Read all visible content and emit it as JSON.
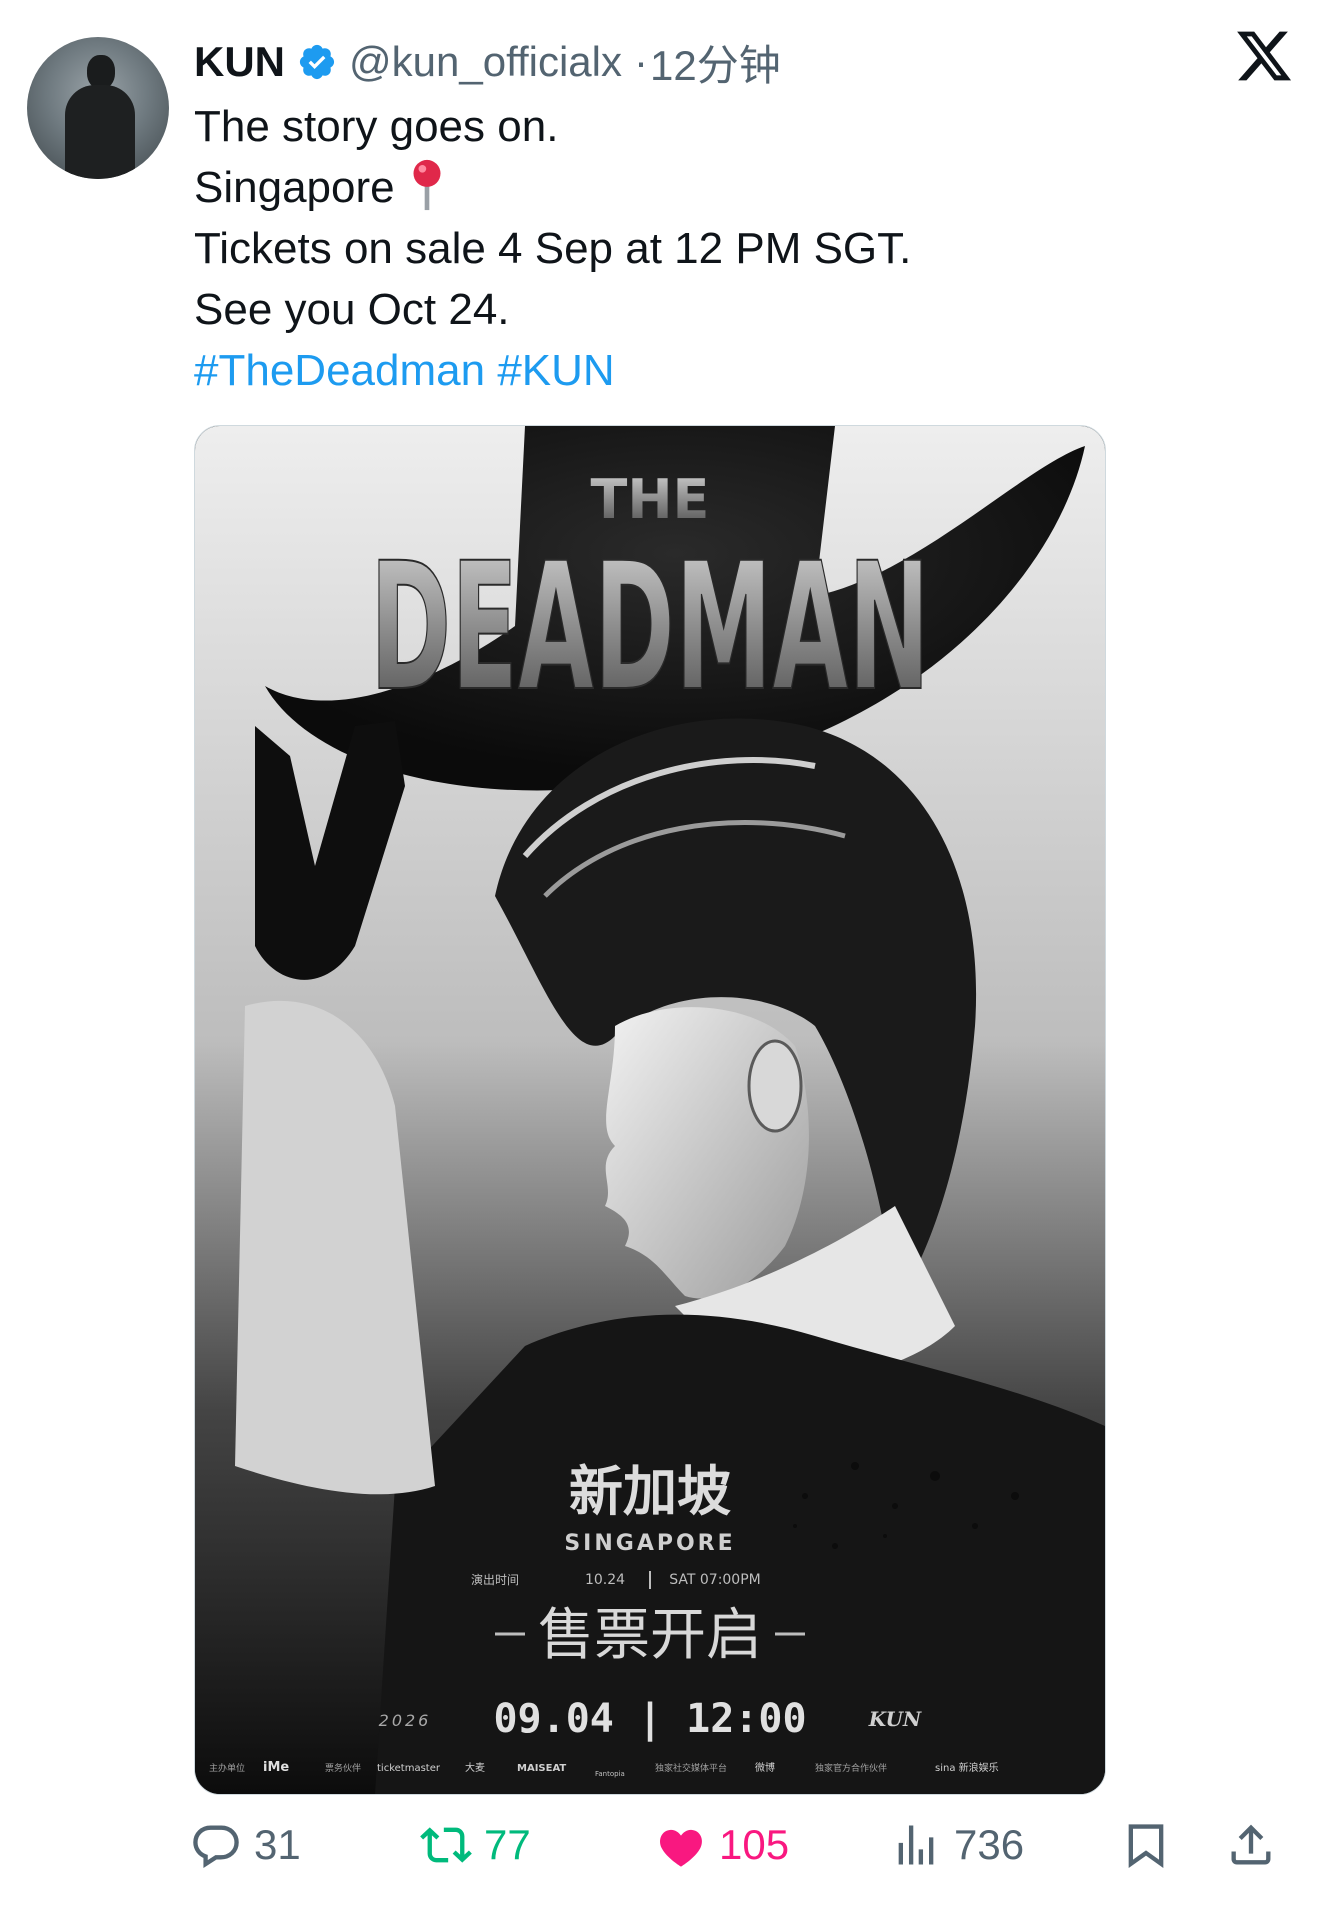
{
  "tweet": {
    "author_name": "KUN",
    "handle": "@kun_officialx",
    "separator": "·",
    "time": "12分钟",
    "text_lines": [
      "The story goes on.",
      "Singapore",
      "Tickets on sale 4 Sep at 12 PM SGT.",
      "See you Oct 24."
    ],
    "hashtags": [
      "#TheDeadman",
      "#KUN"
    ]
  },
  "poster": {
    "title_small": "THE",
    "title_large": "DEADMAN",
    "city_cn": "新加坡",
    "city_en": "SINGAPORE",
    "show_label": "演出时间",
    "show_date": "10.24",
    "show_time": "SAT 07:00PM",
    "sale_title": "售票开启",
    "year": "2026",
    "sale_datetime": "09.04 | 12:00",
    "artist_logo": "KUN",
    "sponsors": [
      "主办单位",
      "iMe",
      "票务伙伴",
      "ticketmaster",
      "大麦",
      "MAISEAT",
      "Fantopia",
      "独家社交媒体平台",
      "微博",
      "独家官方合作伙伴",
      "sina 新浪娱乐"
    ]
  },
  "actions": {
    "replies": "31",
    "retweets": "77",
    "likes": "105",
    "views": "736"
  },
  "colors": {
    "link": "#1d9bf0",
    "secondary_text": "#536471",
    "like": "#f91880",
    "retweet": "#00ba7c"
  },
  "icons": [
    "verified-badge-icon",
    "x-logo-icon",
    "pin-icon",
    "reply-icon",
    "retweet-icon",
    "like-icon",
    "views-icon",
    "bookmark-icon",
    "share-icon"
  ]
}
